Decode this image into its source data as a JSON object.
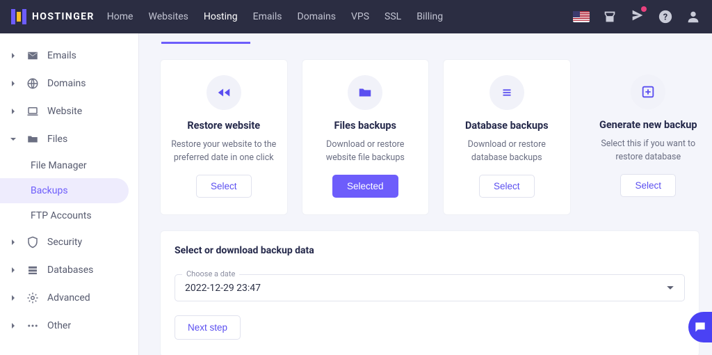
{
  "brand": "HOSTINGER",
  "nav": {
    "items": [
      {
        "label": "Home"
      },
      {
        "label": "Websites"
      },
      {
        "label": "Hosting",
        "active": true
      },
      {
        "label": "Emails"
      },
      {
        "label": "Domains"
      },
      {
        "label": "VPS"
      },
      {
        "label": "SSL"
      },
      {
        "label": "Billing"
      }
    ]
  },
  "sidebar": {
    "items": [
      {
        "label": "Emails",
        "icon": "mail"
      },
      {
        "label": "Domains",
        "icon": "globe"
      },
      {
        "label": "Website",
        "icon": "laptop"
      },
      {
        "label": "Files",
        "icon": "folder",
        "expanded": true,
        "children": [
          {
            "label": "File Manager"
          },
          {
            "label": "Backups",
            "active": true
          },
          {
            "label": "FTP Accounts"
          }
        ]
      },
      {
        "label": "Security",
        "icon": "shield"
      },
      {
        "label": "Databases",
        "icon": "db"
      },
      {
        "label": "Advanced",
        "icon": "gear"
      },
      {
        "label": "Other",
        "icon": "dots"
      }
    ]
  },
  "cards": [
    {
      "title": "Restore website",
      "desc": "Restore your website to the preferred date in one click",
      "btn": "Select",
      "primary": false,
      "icon": "rewind"
    },
    {
      "title": "Files backups",
      "desc": "Download or restore website file backups",
      "btn": "Selected",
      "primary": true,
      "icon": "folder"
    },
    {
      "title": "Database backups",
      "desc": "Download or restore database backups",
      "btn": "Select",
      "primary": false,
      "icon": "list"
    },
    {
      "title": "Generate new backup",
      "desc": "Select this if you want to restore database",
      "btn": "Select",
      "primary": false,
      "icon": "plus"
    }
  ],
  "panel": {
    "title": "Select or download backup data",
    "dateLabel": "Choose a date",
    "dateValue": "2022-12-29 23:47",
    "nextBtn": "Next step"
  }
}
